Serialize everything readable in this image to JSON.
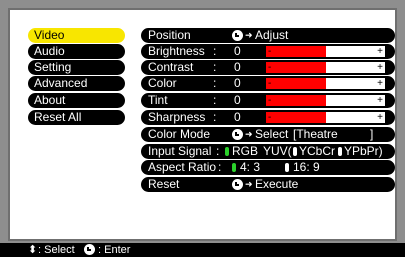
{
  "menu": [
    {
      "label": "Video",
      "active": true
    },
    {
      "label": "Audio"
    },
    {
      "label": "Setting"
    },
    {
      "label": "Advanced"
    },
    {
      "label": "About"
    },
    {
      "label": "Reset All"
    }
  ],
  "settings": {
    "position": {
      "label": "Position",
      "action": "Adjust"
    },
    "brightness": {
      "label": "Brightness",
      "colon": ":",
      "value": "0",
      "level": 0.5,
      "minus": "-",
      "plus": "+"
    },
    "contrast": {
      "label": "Contrast",
      "colon": ":",
      "value": "0",
      "level": 0.5,
      "minus": "-",
      "plus": "+"
    },
    "color": {
      "label": "Color",
      "colon": ":",
      "value": "0",
      "level": 0.5,
      "minus": "-",
      "plus": "+"
    },
    "tint": {
      "label": "Tint",
      "colon": ":",
      "value": "0",
      "level": 0.5,
      "minus": "-",
      "plus": "+"
    },
    "sharpness": {
      "label": "Sharpness",
      "colon": ":",
      "value": "0",
      "level": 0.5,
      "minus": "-",
      "plus": "+"
    },
    "color_mode": {
      "label": "Color Mode",
      "action": "Select",
      "value": "[Theatre",
      "close": "]"
    },
    "input_signal": {
      "label": "Input Signal",
      "colon": ":",
      "opt1": "RGB",
      "opt2": "YUV(",
      "opt3": "YCbCr",
      "opt4": "YPbPr)"
    },
    "aspect_ratio": {
      "label": "Aspect Ratio",
      "colon": ":",
      "opt1": "4: 3",
      "opt2": "16: 9"
    },
    "reset": {
      "label": "Reset",
      "action": "Execute"
    }
  },
  "status": {
    "updown": "⬍",
    "select": ": Select",
    "enter": ": Enter"
  },
  "colors": {
    "accent": "#f8e600",
    "bar": "#ff0000",
    "selected_pill": "#2bd12b"
  }
}
